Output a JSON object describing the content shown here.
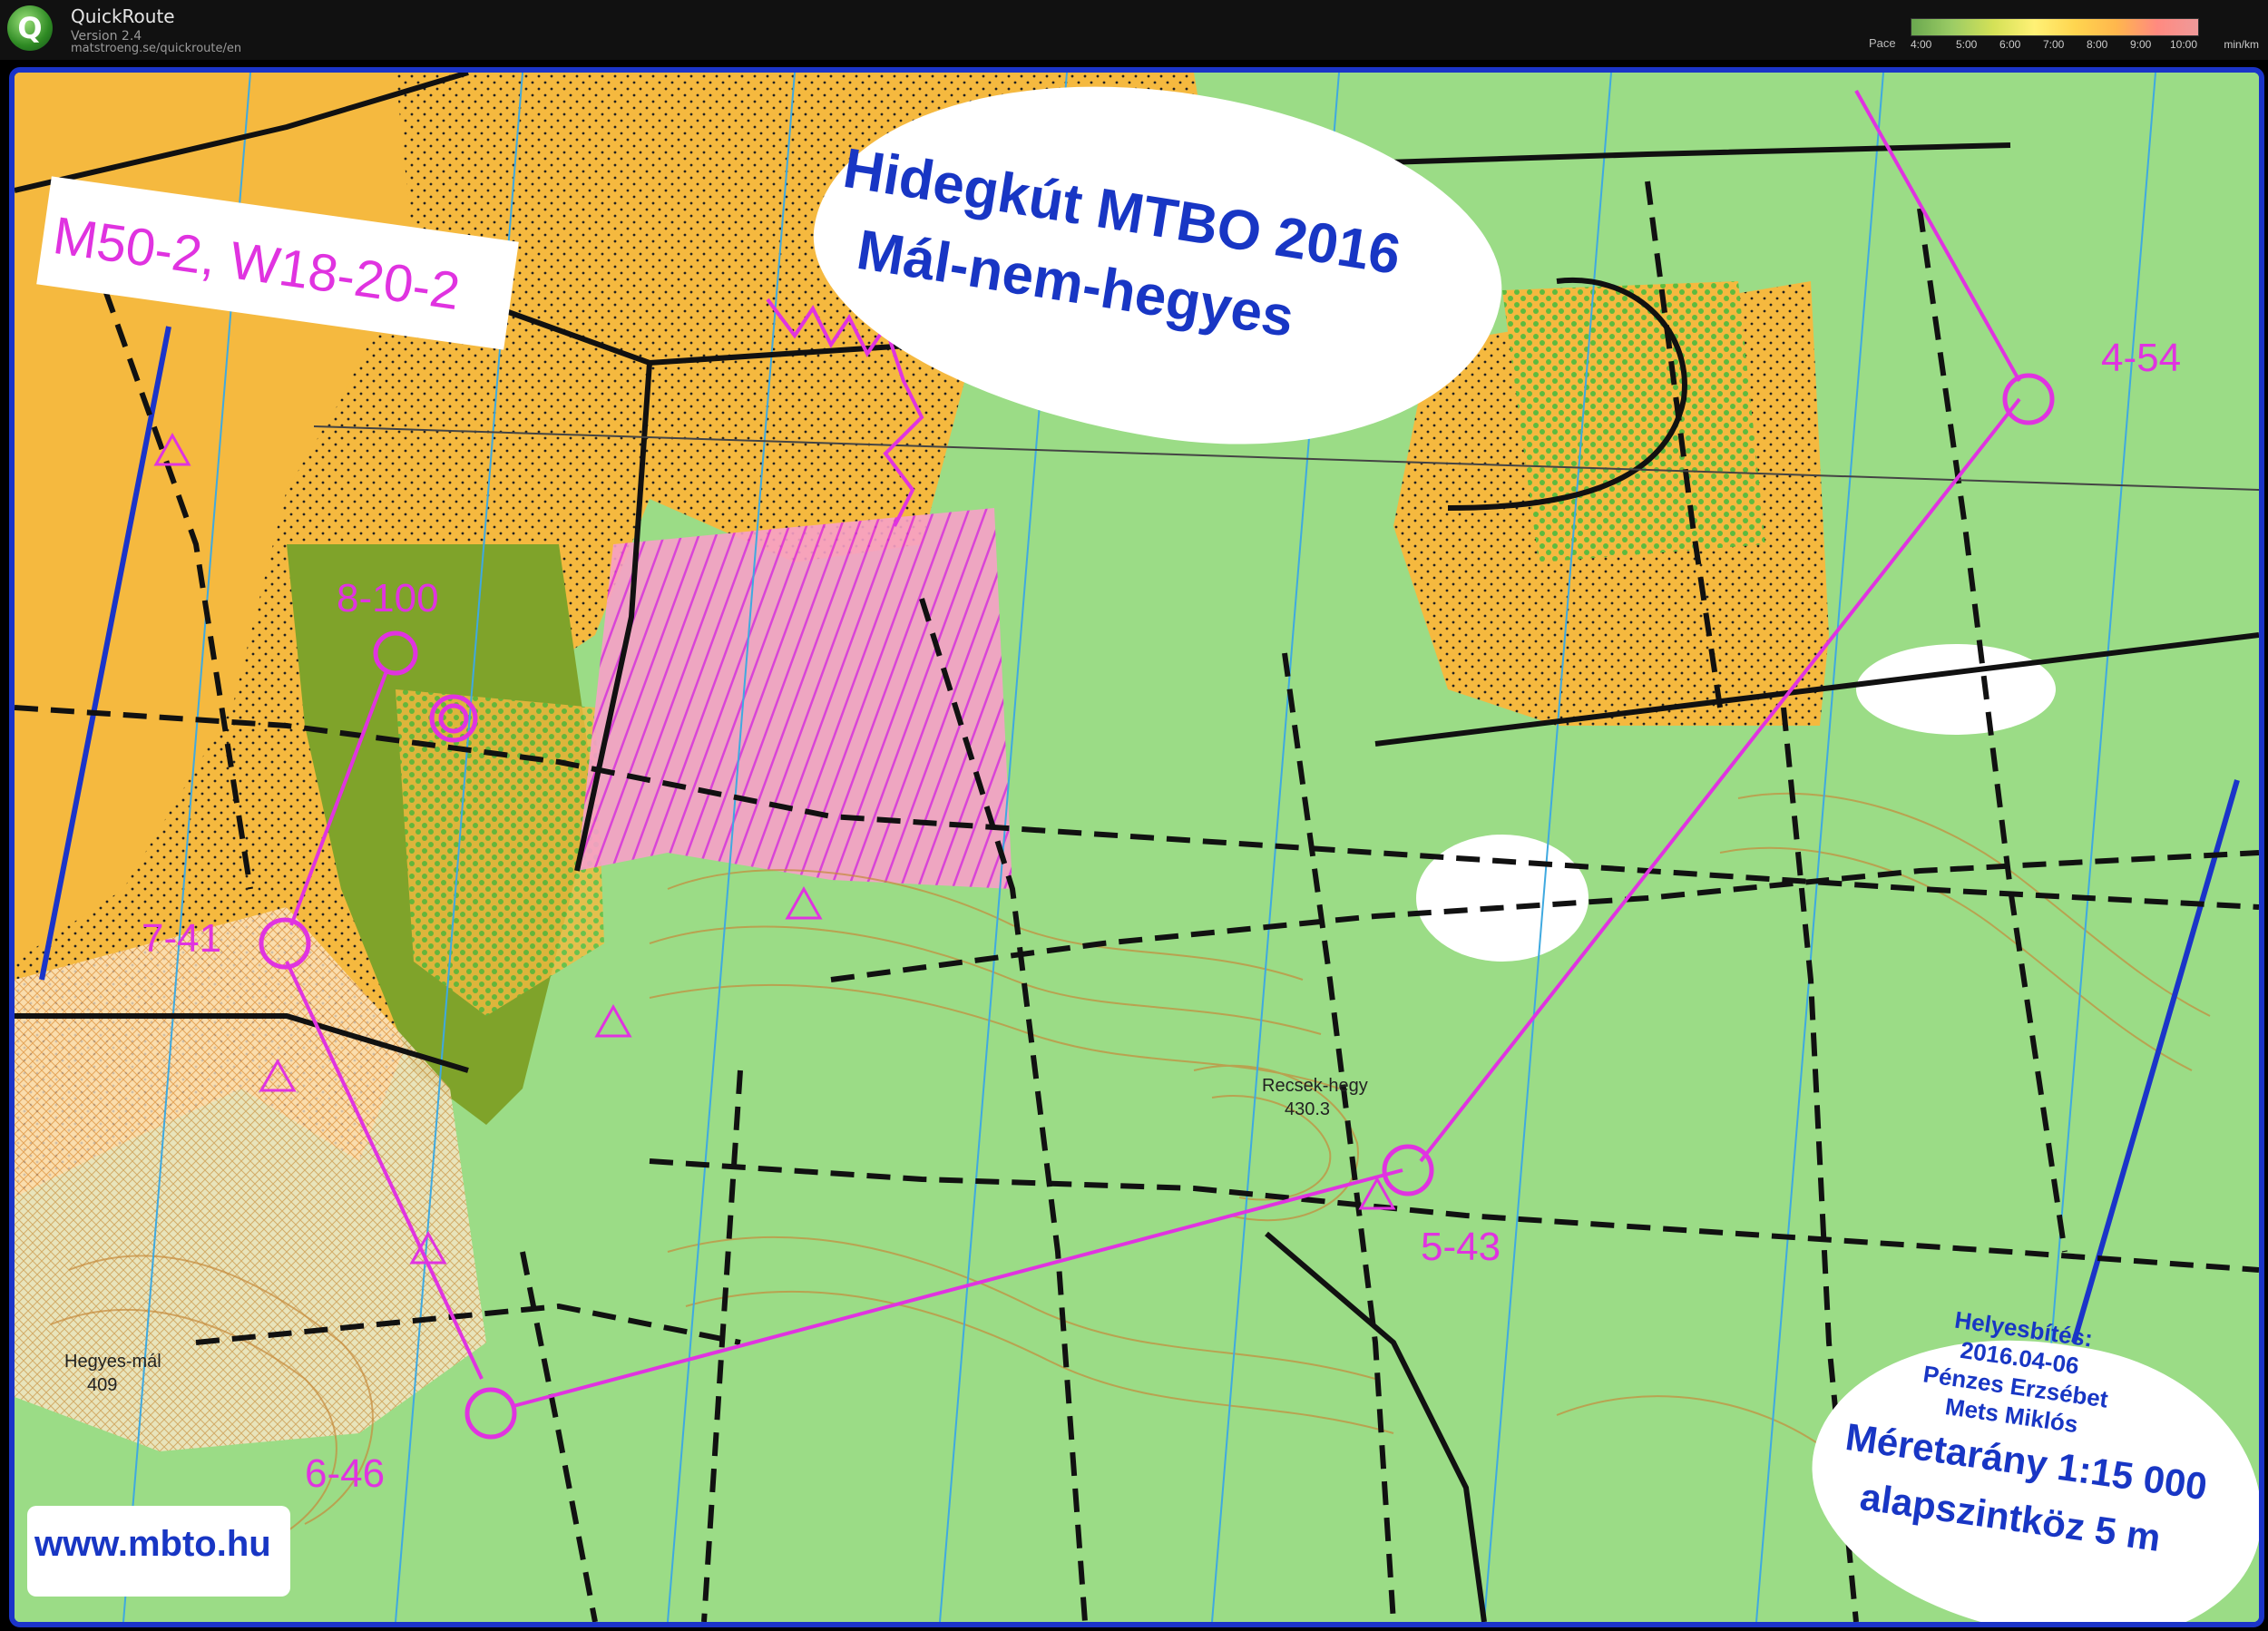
{
  "app": {
    "name": "QuickRoute",
    "version": "Version 2.4",
    "url": "matstroeng.se/quickroute/en",
    "logo_letter": "Q"
  },
  "pace_legend": {
    "label": "Pace",
    "ticks": [
      "4:00",
      "5:00",
      "6:00",
      "7:00",
      "8:00",
      "9:00",
      "10:00"
    ],
    "unit": "min/km"
  },
  "map": {
    "title_line1": "Hidegkút MTBO 2016",
    "title_line2": "Mál-nem-hegyes",
    "course": "M50-2, W18-20-2",
    "revision": [
      "Helyesbítés:",
      "2016.04-06",
      "Pénzes Erzsébet",
      "Mets Miklós"
    ],
    "scale_line1": "Méretarány 1:15 000",
    "scale_line2": "alapszintköz 5 m",
    "website": "www.mbto.hu",
    "place_names": [
      {
        "name": "Recsek-hegy",
        "elevation": "430.3"
      },
      {
        "name": "Hegyes-mál",
        "elevation": "409"
      }
    ],
    "controls": [
      {
        "label": "4-54"
      },
      {
        "label": "5-43"
      },
      {
        "label": "6-46"
      },
      {
        "label": "7-41"
      },
      {
        "label": "8-100"
      }
    ],
    "colors": {
      "forest": "#9bdc86",
      "open_land": "#f5b93f",
      "olive": "#7fa32a",
      "course": "#e033e0",
      "north_lines": "#1b34c9",
      "frame": "#1b34c9",
      "text_blue": "#1836c4"
    }
  }
}
